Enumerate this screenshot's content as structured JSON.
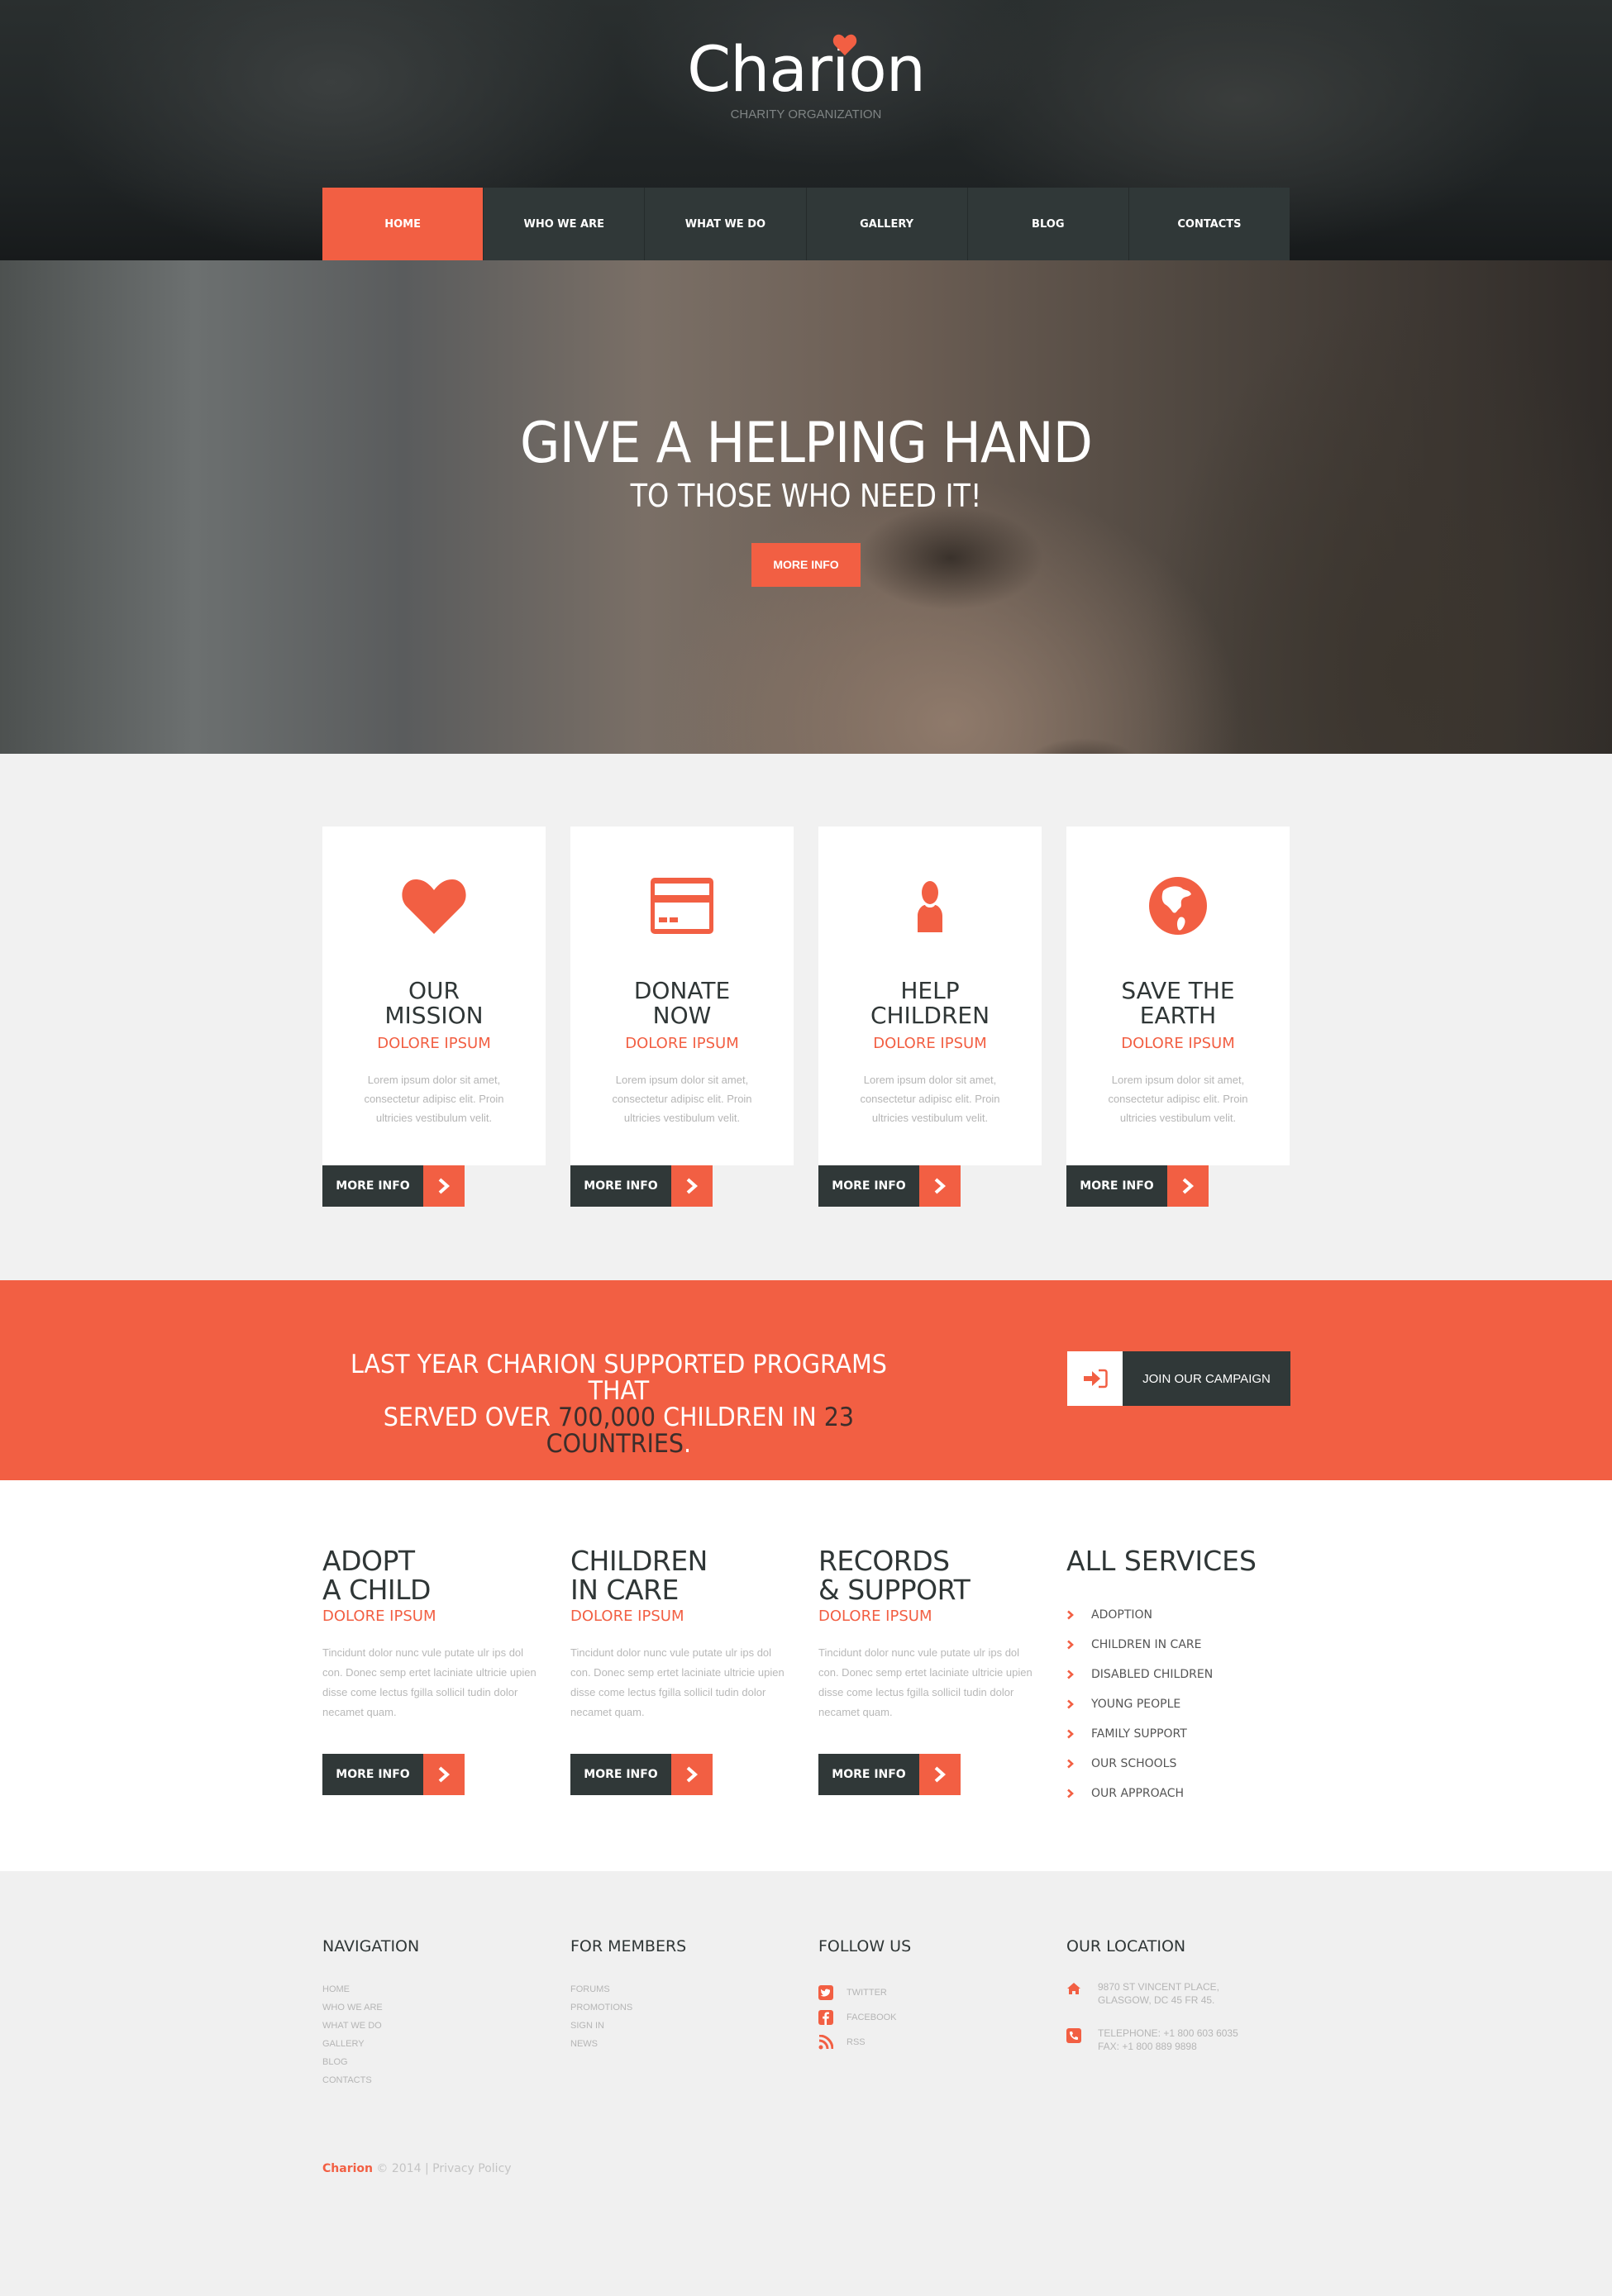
{
  "brand": {
    "name": "Charion",
    "tagline": "CHARITY ORGANIZATION",
    "accent_color": "#f25f43",
    "dark_color": "#303838"
  },
  "nav": {
    "items": [
      {
        "label": "HOME",
        "active": true
      },
      {
        "label": "WHO WE ARE",
        "active": false
      },
      {
        "label": "WHAT WE DO",
        "active": false
      },
      {
        "label": "GALLERY",
        "active": false
      },
      {
        "label": "BLOG",
        "active": false
      },
      {
        "label": "CONTACTS",
        "active": false
      }
    ]
  },
  "hero": {
    "title": "GIVE A HELPING HAND",
    "subtitle": "TO THOSE WHO NEED IT!",
    "button_label": "MORE INFO"
  },
  "features": [
    {
      "icon": "heart-icon",
      "title_line1": "OUR",
      "title_line2": "MISSION",
      "subtitle": "DOLORE IPSUM",
      "text": "Lorem ipsum dolor sit amet, consectetur adipisc elit. Proin ultricies vestibulum velit.",
      "button_label": "MORE INFO"
    },
    {
      "icon": "credit-card-icon",
      "title_line1": "DONATE",
      "title_line2": "NOW",
      "subtitle": "DOLORE IPSUM",
      "text": "Lorem ipsum dolor sit amet, consectetur adipisc elit. Proin ultricies vestibulum velit.",
      "button_label": "MORE INFO"
    },
    {
      "icon": "user-icon",
      "title_line1": "HELP",
      "title_line2": "CHILDREN",
      "subtitle": "DOLORE IPSUM",
      "text": "Lorem ipsum dolor sit amet, consectetur adipisc elit. Proin ultricies vestibulum velit.",
      "button_label": "MORE INFO"
    },
    {
      "icon": "globe-icon",
      "title_line1": "SAVE THE",
      "title_line2": "EARTH",
      "subtitle": "DOLORE IPSUM",
      "text": "Lorem ipsum dolor sit amet, consectetur adipisc elit. Proin ultricies vestibulum velit.",
      "button_label": "MORE INFO"
    }
  ],
  "stats": {
    "line1": "LAST YEAR CHARION SUPPORTED PROGRAMS THAT",
    "line2_pre": "SERVED OVER ",
    "children_count": "700,000",
    "line2_mid": " CHILDREN IN ",
    "countries_count": "23 COUNTRIES",
    "line2_end": ".",
    "button_label": "JOIN OUR CAMPAIGN"
  },
  "services": [
    {
      "title_line1": "ADOPT",
      "title_line2": "A CHILD",
      "subtitle": "DOLORE IPSUM",
      "text": "Tincidunt dolor nunc vule putate ulr ips dol con. Donec semp ertet laciniate ultricie upien disse come lectus fgilla sollicil tudin dolor necamet quam.",
      "button_label": "MORE INFO"
    },
    {
      "title_line1": "CHILDREN",
      "title_line2": "IN CARE",
      "subtitle": "DOLORE IPSUM",
      "text": "Tincidunt dolor nunc vule putate ulr ips dol con. Donec semp ertet laciniate ultricie upien disse come lectus fgilla sollicil tudin dolor necamet quam.",
      "button_label": "MORE INFO"
    },
    {
      "title_line1": "RECORDS",
      "title_line2": "& SUPPORT",
      "subtitle": "DOLORE IPSUM",
      "text": "Tincidunt dolor nunc vule putate ulr ips dol con. Donec semp ertet laciniate ultricie upien disse come lectus fgilla sollicil tudin dolor necamet quam.",
      "button_label": "MORE INFO"
    }
  ],
  "all_services": {
    "title": "ALL SERVICES",
    "items": [
      "ADOPTION",
      "CHILDREN IN CARE",
      "DISABLED CHILDREN",
      "YOUNG PEOPLE",
      "FAMILY SUPPORT",
      "OUR SCHOOLS",
      "OUR APPROACH"
    ]
  },
  "footer": {
    "navigation": {
      "title": "NAVIGATION",
      "items": [
        "HOME",
        "WHO WE ARE",
        "WHAT WE DO",
        "GALLERY",
        "BLOG",
        "CONTACTS"
      ]
    },
    "members": {
      "title": "FOR MEMBERS",
      "items": [
        "FORUMS",
        "PROMOTIONS",
        "SIGN IN",
        "NEWS"
      ]
    },
    "follow": {
      "title": "FOLLOW US",
      "items": [
        {
          "icon": "twitter-icon",
          "label": "TWITTER"
        },
        {
          "icon": "facebook-icon",
          "label": "FACEBOOK"
        },
        {
          "icon": "rss-icon",
          "label": "RSS"
        }
      ]
    },
    "location": {
      "title": "OUR LOCATION",
      "address_line1": "9870 ST VINCENT PLACE,",
      "address_line2": "GLASGOW, DC 45 FR 45.",
      "telephone": "TELEPHONE: +1 800 603 6035",
      "fax": "FAX: +1 800 889 9898"
    },
    "copyright": {
      "brand": "Charion",
      "text": " © 2014 | ",
      "privacy_label": "Privacy Policy"
    }
  }
}
